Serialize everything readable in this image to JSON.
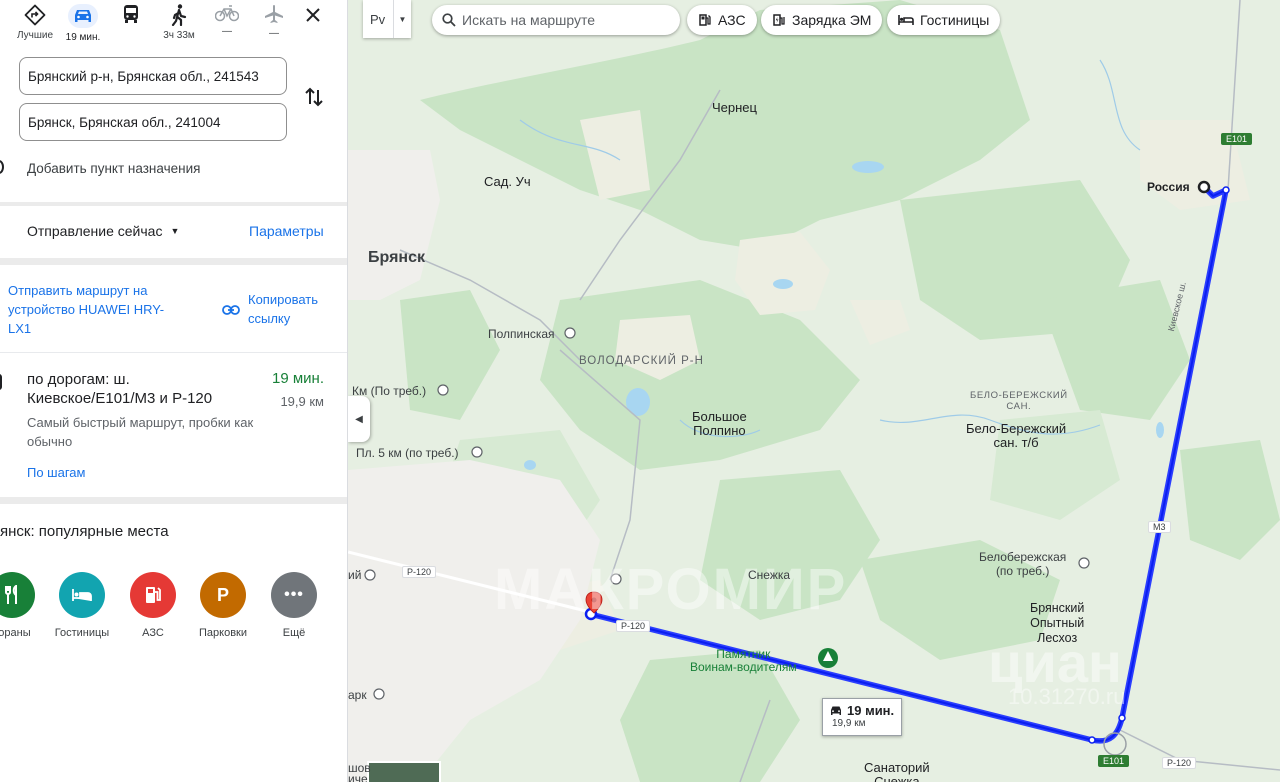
{
  "modes": [
    {
      "label": "Лучшие"
    },
    {
      "label": "19 мин."
    },
    {
      "label": ""
    },
    {
      "label": "3ч 33м"
    },
    {
      "label": "—"
    },
    {
      "label": "—"
    }
  ],
  "route_inputs": {
    "origin": "Брянский р-н, Брянская обл., 241543",
    "destination": "Брянск, Брянская обл., 241004",
    "add_label": "Добавить пункт назначения"
  },
  "departure": {
    "label": "Отправление сейчас",
    "options_link": "Параметры"
  },
  "share": {
    "send_l1": "Отправить маршрут на",
    "send_l2": "устройство HUAWEI HRY-",
    "send_l3": "LX1",
    "copy_l1": "Копировать",
    "copy_l2": "ссылку"
  },
  "route": {
    "title_l1": "по дорогам: ш.",
    "title_l2": "Киевское/E101/M3 и Р-120",
    "time": "19 мин.",
    "distance": "19,9 км",
    "note_l1": "Самый быстрый маршрут, пробки как",
    "note_l2": "обычно",
    "steps_link": "По шагам"
  },
  "popular": {
    "title": "янск: популярные места",
    "categories": [
      {
        "label": "тораны"
      },
      {
        "label": "Гостиницы"
      },
      {
        "label": "АЗС"
      },
      {
        "label": "Парковки"
      },
      {
        "label": "Ещё"
      }
    ]
  },
  "search": {
    "placeholder": "Искать на маршруте",
    "lang_btn": "Рv"
  },
  "chips": [
    {
      "label": "АЗС"
    },
    {
      "label": "Зарядка ЭМ"
    },
    {
      "label": "Гостиницы"
    }
  ],
  "map_labels": {
    "chernec": "Чернец",
    "sad": "Сад. Уч",
    "bryansk": "Брянск",
    "russia": "Россия",
    "polpinskaya": "Полпинская",
    "volodarsky": "ВОЛОДАРСКИЙ Р-Н",
    "km": "Км (По треб.)",
    "pl5": "Пл. 5 км (по треб.)",
    "bolshoe_l1": "Большое",
    "bolshoe_l2": "Полпино",
    "belo_san_l1": "БЕЛО-БЕРЕЖСКИЙ",
    "belo_san_l2": "САН.",
    "belo_tb_l1": "Бело-Бережский",
    "belo_tb_l2": "сан. т/б",
    "snezhka": "Снежка",
    "beloberezh_l1": "Белобережская",
    "beloberezh_l2": "(по треб.)",
    "lesxoz_l1": "Брянский",
    "lesxoz_l2": "Опытный",
    "lesxoz_l3": "Лесхоз",
    "pamyatnik_l1": "Памятник",
    "pamyatnik_l2": "Воинам-водителям",
    "sanatoriy_l1": "Санаторий",
    "sanatoriy_l2": "Снежка",
    "left_a": "ий",
    "left_b": "арк",
    "left_c": "шов",
    "left_d": "иче"
  },
  "road_shields": {
    "e101_top": "E101",
    "m3_side": "М3",
    "e101_bottom": "E101",
    "r120_left": "Р-120",
    "r120_mid": "Р-120",
    "r120_right": "Р-120",
    "kiev_vert": "Киевское ш."
  },
  "route_badge": {
    "time": "19 мин.",
    "distance": "19,9 км"
  },
  "watermarks": {
    "makromir": "МАКРОМИР",
    "cian": "циан",
    "cian_num": "10.31270.ru"
  },
  "colors": {
    "route": "#1a40ff",
    "accent": "#1a73e8",
    "green_time": "#188038",
    "restaurants": "#188038",
    "hotels": "#12a4b0",
    "gas": "#e53935",
    "parking": "#c26a00",
    "more": "#70757a"
  }
}
